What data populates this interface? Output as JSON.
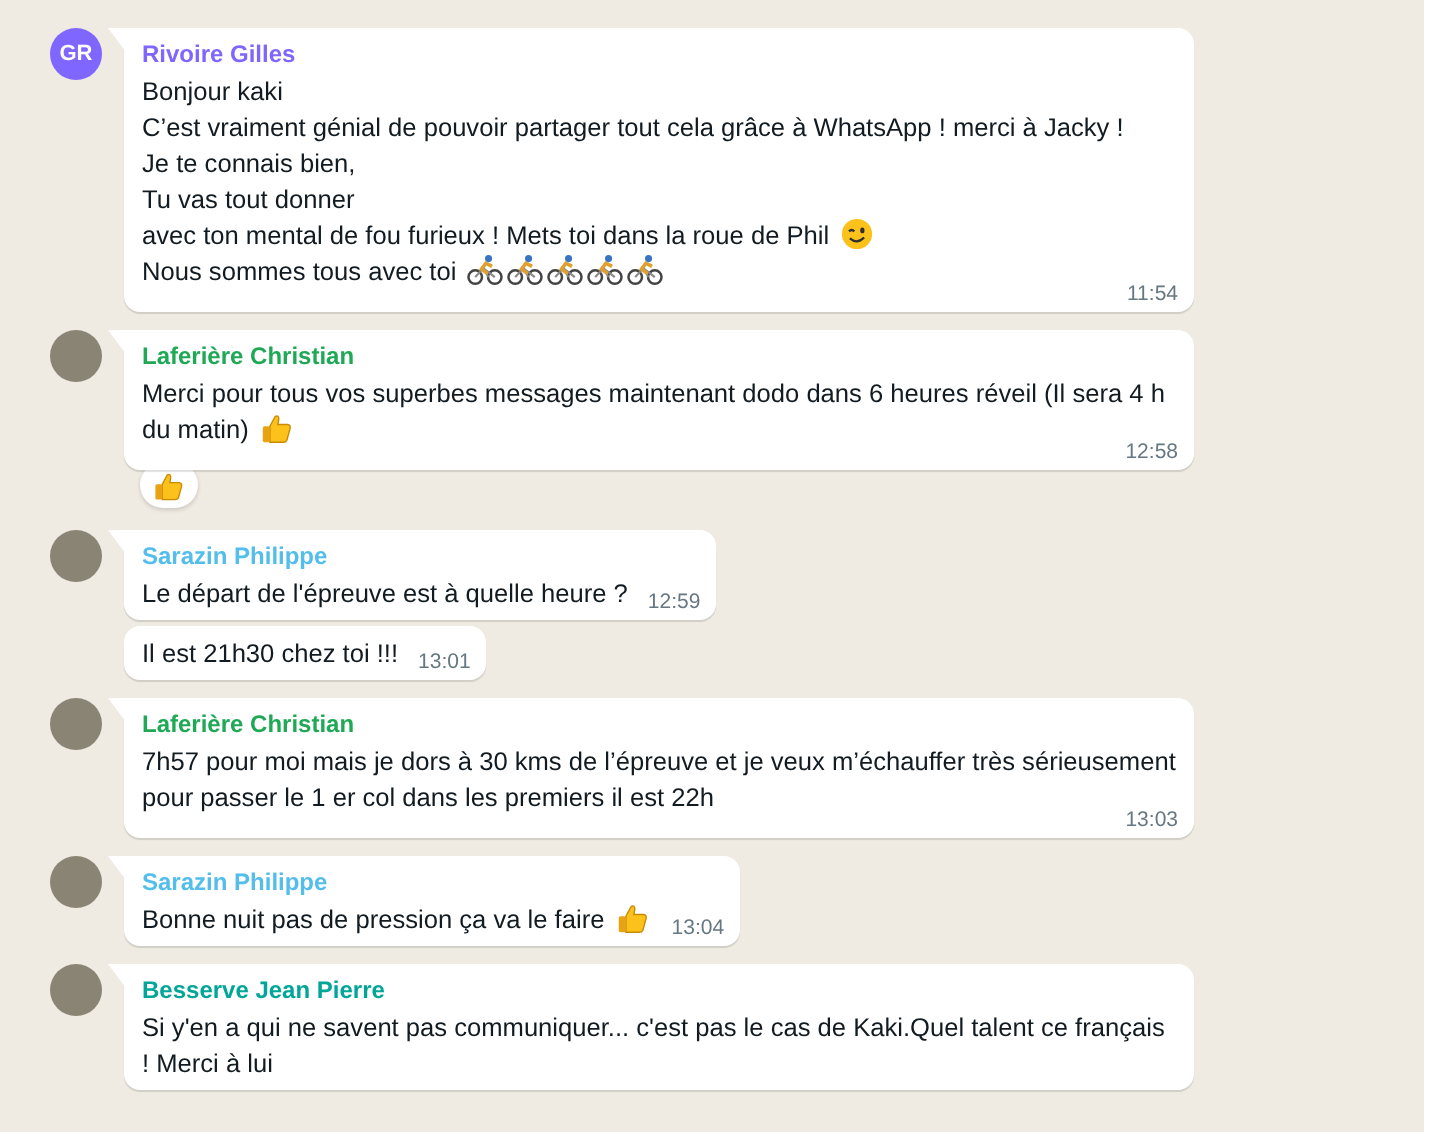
{
  "groups": [
    {
      "sender": "Rivoire Gilles",
      "color": "#7f66ff",
      "avatar": {
        "kind": "initials",
        "initials": "GR"
      },
      "messages": [
        {
          "lines": [
            {
              "text": "Bonjour kaki"
            },
            {
              "text": "C’est vraiment génial de pouvoir partager tout cela grâce à WhatsApp !  merci à Jacky !"
            },
            {
              "text": "Je te connais bien,"
            },
            {
              "text": "Tu vas tout donner"
            },
            {
              "text": "avec ton mental de fou furieux ! Mets toi dans la roue de Phil",
              "kind": "wink"
            },
            {
              "text": "Nous sommes tous avec toi",
              "kind": "cyclists"
            }
          ],
          "time": "11:54"
        }
      ]
    },
    {
      "sender": "Laferière Christian",
      "color": "#1fa855",
      "avatar": {
        "kind": "photo"
      },
      "messages": [
        {
          "lines": [
            {
              "text": "Merci pour tous vos superbes messages maintenant dodo dans 6 heures réveil (Il sera 4 h du matin)",
              "kind": "thumb"
            }
          ],
          "time": "12:58",
          "reaction": {
            "kind": "thumb"
          }
        }
      ]
    },
    {
      "sender": "Sarazin Philippe",
      "color": "#53bdeb",
      "avatar": {
        "kind": "photo"
      },
      "messages": [
        {
          "lines": [
            {
              "text": "Le départ de l'épreuve est à quelle heure ?"
            }
          ],
          "time": "12:59"
        },
        {
          "lines": [
            {
              "text": "Il est 21h30 chez toi !!!"
            }
          ],
          "time": "13:01"
        }
      ]
    },
    {
      "sender": "Laferière Christian",
      "color": "#1fa855",
      "avatar": {
        "kind": "photo"
      },
      "messages": [
        {
          "lines": [
            {
              "text": "7h57 pour moi mais je dors à 30 kms de l’épreuve et je veux m’échauffer très sérieusement pour passer le 1 er col dans les premiers il est 22h"
            }
          ],
          "time": "13:03"
        }
      ]
    },
    {
      "sender": "Sarazin Philippe",
      "color": "#53bdeb",
      "avatar": {
        "kind": "photo"
      },
      "messages": [
        {
          "lines": [
            {
              "text": "Bonne nuit pas de pression ça va le faire",
              "kind": "thumb"
            }
          ],
          "time": "13:04"
        }
      ]
    },
    {
      "sender": "Besserve Jean Pierre",
      "color": "#02a698",
      "avatar": {
        "kind": "photo"
      },
      "messages": [
        {
          "lines": [
            {
              "text": "Si y'en a qui ne savent pas communiquer... c'est pas le cas de Kaki.Quel talent ce français ! Merci à lui"
            }
          ]
        }
      ]
    }
  ]
}
